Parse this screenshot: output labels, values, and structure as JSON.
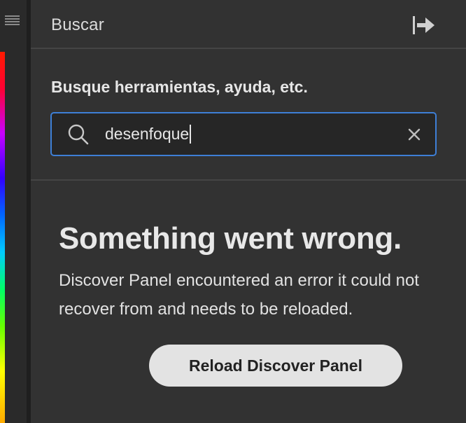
{
  "panel": {
    "title": "Buscar",
    "collapse_icon": "collapse-panel-icon"
  },
  "search": {
    "label": "Busque herramientas, ayuda, etc.",
    "value": "desenfoque",
    "icon": "search-icon",
    "clear_icon": "close-icon",
    "focus_color": "#3e7fd6"
  },
  "error": {
    "title": "Something went wrong.",
    "message": "Discover Panel encountered an error it could not recover from and needs to be reloaded.",
    "button_label": "Reload Discover Panel"
  }
}
